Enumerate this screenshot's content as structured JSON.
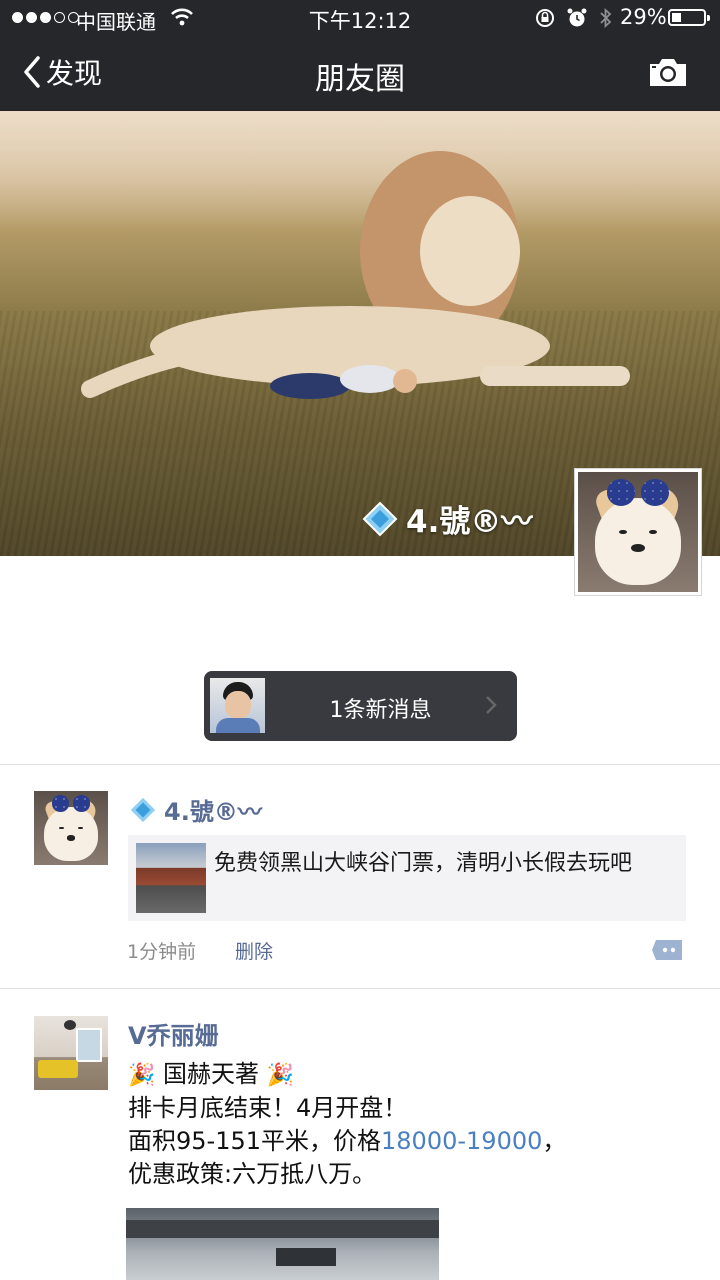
{
  "status_bar": {
    "carrier": "中国联通",
    "time": "下午12:12",
    "battery_percent": "29%",
    "battery_level": 0.29
  },
  "nav": {
    "back_label": "发现",
    "title": "朋友圈"
  },
  "cover": {
    "username": "4.號®〰"
  },
  "new_message": {
    "label": "1条新消息"
  },
  "posts": [
    {
      "name": "4.號®〰",
      "link_title": "免费领黑山大峡谷门票，清明小长假去玩吧",
      "time": "1分钟前",
      "delete_label": "删除"
    },
    {
      "name": "V乔丽姗",
      "line1": "国赫天著",
      "line2": "排卡月底结束！4月开盘！",
      "line3_prefix": "面积95-151平米，价格",
      "line3_link": "18000-19000",
      "line3_suffix": "，",
      "line4": "优惠政策:六万抵八万。"
    }
  ],
  "colors": {
    "nav_background": "#26272b",
    "name_blue": "#576b95",
    "link_blue": "#4a7fc1",
    "pill_background": "#393a3f"
  },
  "icons": {
    "back": "chevron-left-icon",
    "camera": "camera-icon",
    "wifi": "wifi-icon",
    "diamond": "diamond-icon",
    "comment": "comment-icon",
    "party": "party-popper-icon"
  }
}
